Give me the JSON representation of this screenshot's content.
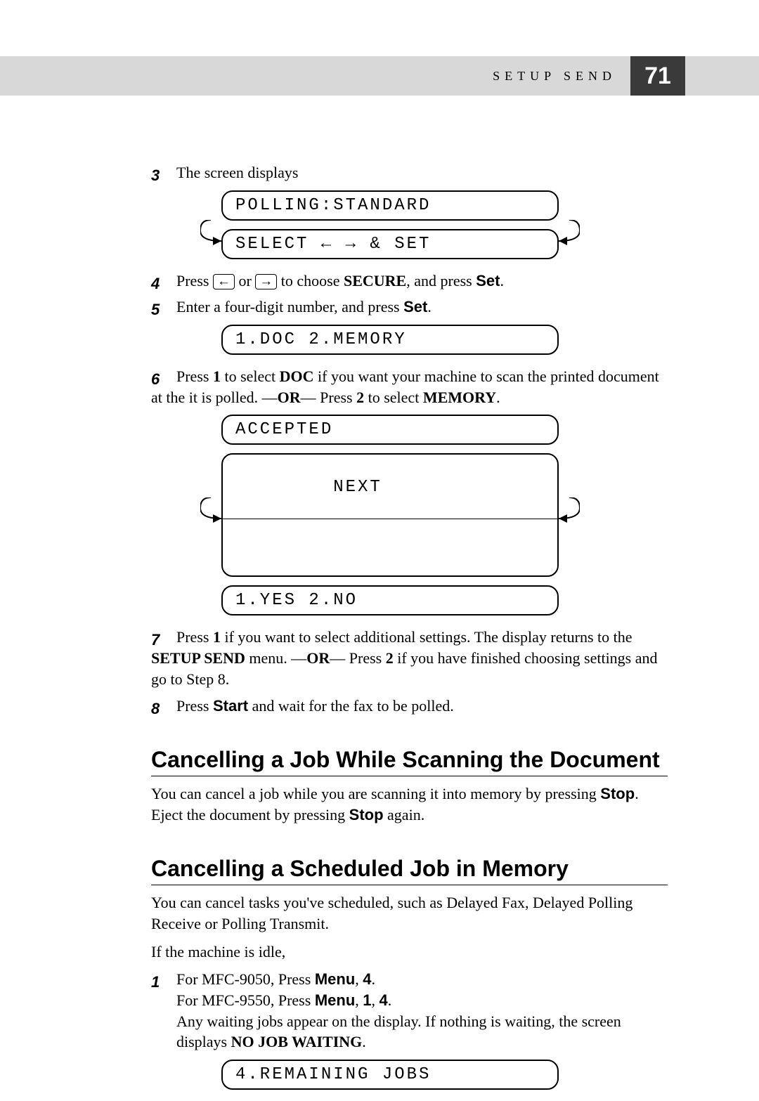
{
  "header": {
    "section": "SETUP SEND",
    "page": "71"
  },
  "steps": {
    "s3": {
      "num": "3",
      "text": "The screen displays"
    },
    "s4": {
      "num": "4",
      "t1": "Press ",
      "key1": "←",
      "t2": " or ",
      "key2": "→",
      "t3": " to choose ",
      "b1": "SECURE",
      "t4": ", and press ",
      "b2": "Set",
      "t5": "."
    },
    "s5": {
      "num": "5",
      "t1": "Enter a four-digit number, and press ",
      "b1": "Set",
      "t2": "."
    },
    "s6": {
      "num": "6",
      "t1": "Press ",
      "b1": "1",
      "t2": " to select ",
      "b2": "DOC",
      "t3": " if you want your machine to scan the printed document at the it is polled. —",
      "b3": "OR",
      "t4": "— Press ",
      "b4": "2",
      "t5": " to select ",
      "b5": "MEMORY",
      "t6": "."
    },
    "s7": {
      "num": "7",
      "t1": "Press ",
      "b1": "1",
      "t2": " if you want to select additional settings. The display returns to the ",
      "b2": "SETUP SEND",
      "t3": " menu. —",
      "b3": "OR",
      "t4": "— Press ",
      "b4": "2",
      "t5": " if you have finished choosing settings and go to Step 8."
    },
    "s8": {
      "num": "8",
      "t1": "Press ",
      "b1": "Start",
      "t2": " and wait for the fax to be polled."
    }
  },
  "lcd": {
    "polling": "POLLING:STANDARD",
    "select": "SELECT ← → & SET",
    "docmem": "1.DOC 2.MEMORY",
    "accepted": "ACCEPTED",
    "next": "NEXT",
    "yesno": "1.YES 2.NO",
    "remaining": "4.REMAINING JOBS"
  },
  "cancel_scan": {
    "title": "Cancelling a Job While Scanning the Document",
    "p_a": "You can cancel a job while you are scanning it into memory by pressing ",
    "b1": "Stop",
    "p_b": ". Eject the document by pressing ",
    "b2": "Stop",
    "p_c": " again."
  },
  "cancel_sched": {
    "title": "Cancelling a Scheduled Job in Memory",
    "p1": "You can cancel tasks you've scheduled, such as Delayed Fax, Delayed Polling Receive or Polling Transmit.",
    "p2": "If the machine is idle,",
    "s1": {
      "num": "1",
      "l1a": "For MFC-9050, Press ",
      "l1b": "Menu",
      "l1c": ", ",
      "l1d": "4",
      "l1e": ".",
      "l2a": "For MFC-9550, Press ",
      "l2b": "Menu",
      "l2c": ", ",
      "l2d": "1",
      "l2e": ", ",
      "l2f": "4",
      "l2g": ".",
      "l3a": "Any waiting jobs appear on the display. If nothing is waiting, the screen displays ",
      "l3b": "NO JOB WAITING",
      "l3c": "."
    }
  }
}
